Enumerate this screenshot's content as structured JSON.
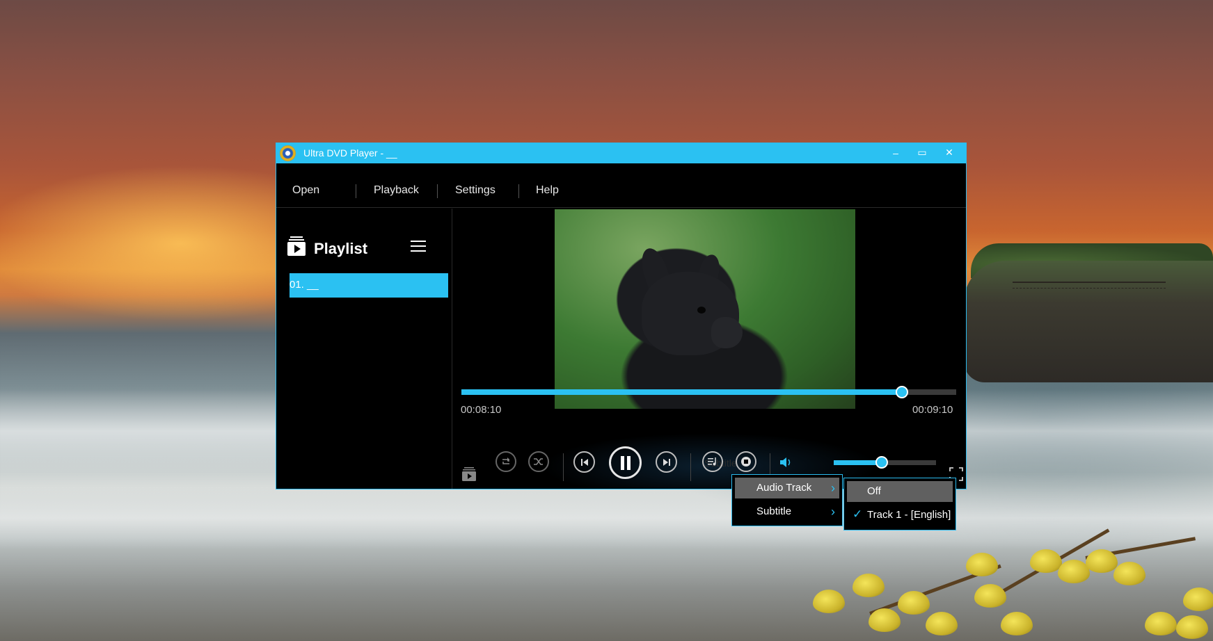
{
  "window": {
    "title": "Ultra DVD Player - __",
    "controls": {
      "minimize": "–",
      "maximize": "▭",
      "close": "✕"
    }
  },
  "menubar": {
    "items": [
      {
        "label": "Open"
      },
      {
        "label": "Playback"
      },
      {
        "label": "Settings"
      },
      {
        "label": "Help"
      }
    ]
  },
  "playlist": {
    "title": "Playlist",
    "items": [
      {
        "label": "01. __",
        "selected": true
      }
    ]
  },
  "player": {
    "current_time": "00:08:10",
    "total_time": "00:09:10",
    "progress_fraction": 0.89,
    "volume_fraction": 0.47,
    "faded_label": "Subtitle"
  },
  "context_menu": {
    "items": [
      {
        "label": "Audio Track",
        "highlighted": true,
        "has_submenu": true
      },
      {
        "label": "Subtitle",
        "highlighted": false,
        "has_submenu": true
      }
    ]
  },
  "audio_submenu": {
    "items": [
      {
        "label": "Off",
        "highlighted": true,
        "checked": false
      },
      {
        "label": "Track 1 - [English]",
        "highlighted": false,
        "checked": true
      }
    ]
  },
  "colors": {
    "accent": "#2bc1f2",
    "window_bg": "#000000",
    "menu_highlight": "#606060"
  }
}
